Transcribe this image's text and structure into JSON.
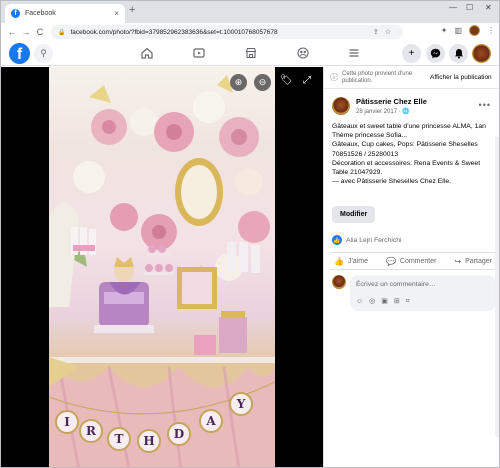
{
  "browser": {
    "tab_title": "Facebook",
    "tab_close": "×",
    "new_tab": "+",
    "url": "facebook.com/photo/?fbid=379852962383636&set=t.100010768057678",
    "nav_back": "←",
    "nav_forward": "→",
    "nav_reload": "C",
    "win_min": "—",
    "win_max": "☐",
    "win_close": "✕"
  },
  "post": {
    "notice_text": "Cette photo provient d'une publication.",
    "notice_link": "Afficher la publication",
    "author": "Pâtisserie Chez Elle",
    "date": "28 janvier 2017",
    "text_lines": [
      "Gâteaux et sweet table d'une princesse ALMA, 1an",
      "Thème princesse Sofia...",
      "Gâteaux, Cup cakes, Pops: Pâtisserie Sheselles 70851526 / 25280013",
      "Décoration et accessoires: Rena Events & Sweet Table 21047929.",
      "— avec Pâtisserie Sheselles Chez Elle."
    ],
    "edit_label": "Modifier",
    "reaction_name": "Alia Lejri Ferchichi",
    "actions": {
      "like": "J'aime",
      "comment": "Commenter",
      "share": "Partager"
    },
    "comment_placeholder": "Écrivez un commentaire…"
  },
  "photo": {
    "banner_letters": [
      "I",
      "R",
      "T",
      "H",
      "D",
      "A",
      "Y"
    ]
  },
  "colors": {
    "fb_blue": "#1877f2",
    "background": "#ffffff",
    "photo_bg": "#000000"
  }
}
